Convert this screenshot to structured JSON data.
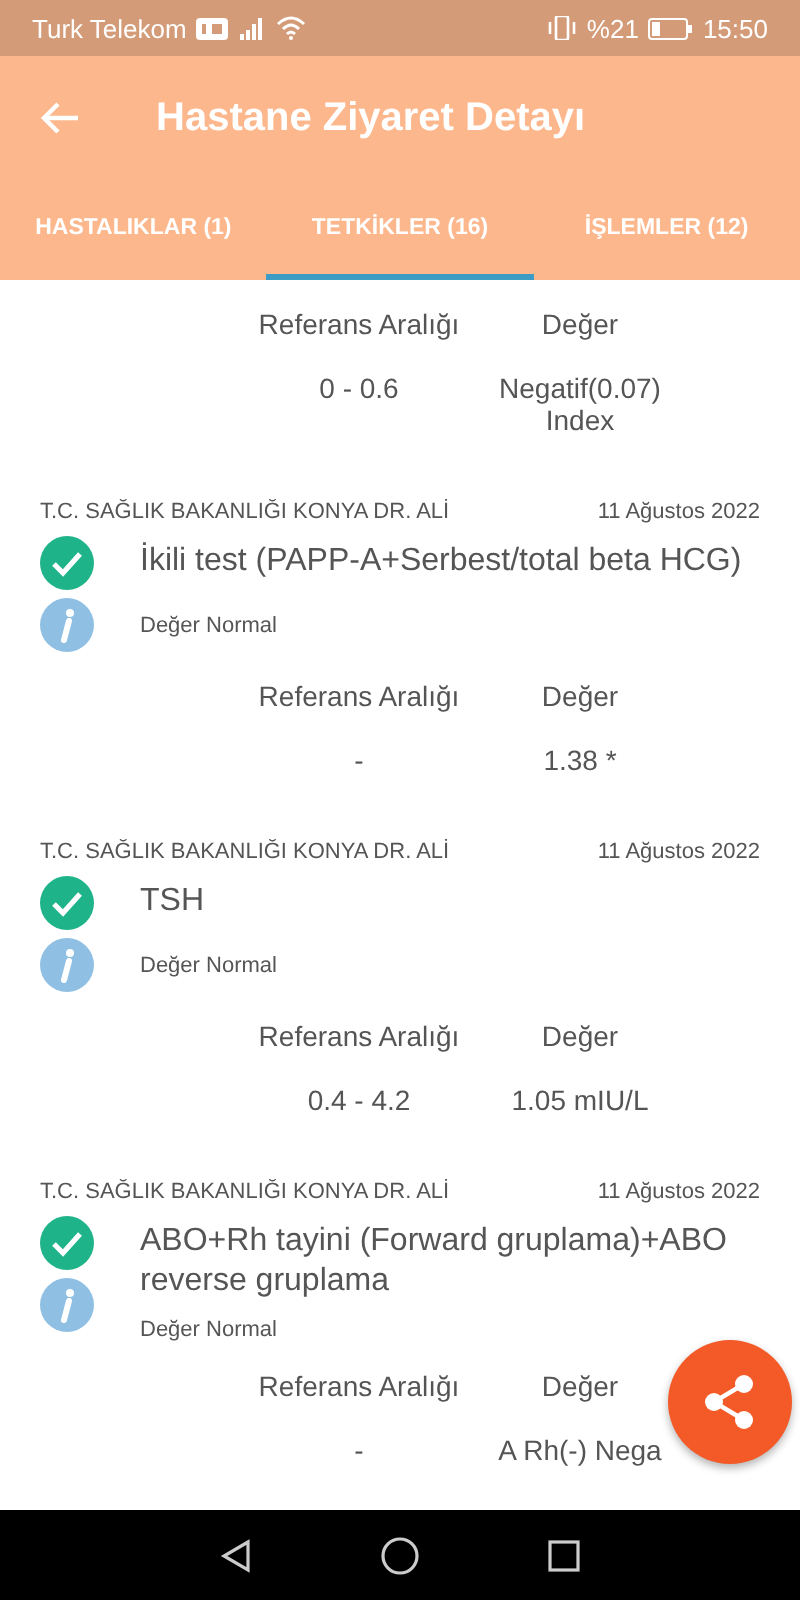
{
  "status_bar": {
    "carrier": "Turk Telekom",
    "battery": "%21",
    "time": "15:50"
  },
  "app_bar": {
    "title": "Hastane Ziyaret Detayı"
  },
  "tabs": [
    {
      "label": "HASTALIKLAR (1)",
      "selected": false
    },
    {
      "label": "TETKİKLER (16)",
      "selected": true
    },
    {
      "label": "İŞLEMLER (12)",
      "selected": false
    }
  ],
  "partial_result": {
    "reference_label": "Referans Aralığı",
    "value_label": "Değer",
    "reference": "0 - 0.6",
    "value": "Negatif(0.07) Index"
  },
  "tests": [
    {
      "source": "T.C. SAĞLIK BAKANLIĞI KONYA DR. ALİ",
      "date": "11 Ağustos 2022",
      "title": "İkili test (PAPP-A+Serbest/total beta HCG)",
      "status": "Değer Normal",
      "reference_label": "Referans Aralığı",
      "value_label": "Değer",
      "reference": "-",
      "value": "1.38 *"
    },
    {
      "source": "T.C. SAĞLIK BAKANLIĞI KONYA DR. ALİ",
      "date": "11 Ağustos 2022",
      "title": "TSH",
      "status": "Değer Normal",
      "reference_label": "Referans Aralığı",
      "value_label": "Değer",
      "reference": "0.4 - 4.2",
      "value": "1.05 mIU/L"
    },
    {
      "source": "T.C. SAĞLIK BAKANLIĞI KONYA DR. ALİ",
      "date": "11 Ağustos 2022",
      "title": "ABO+Rh tayini   (Forward gruplama)+ABO reverse gruplama",
      "status": "Değer Normal",
      "reference_label": "Referans Aralığı",
      "value_label": "Değer",
      "reference": "-",
      "value": "A Rh(-) Nega"
    }
  ]
}
